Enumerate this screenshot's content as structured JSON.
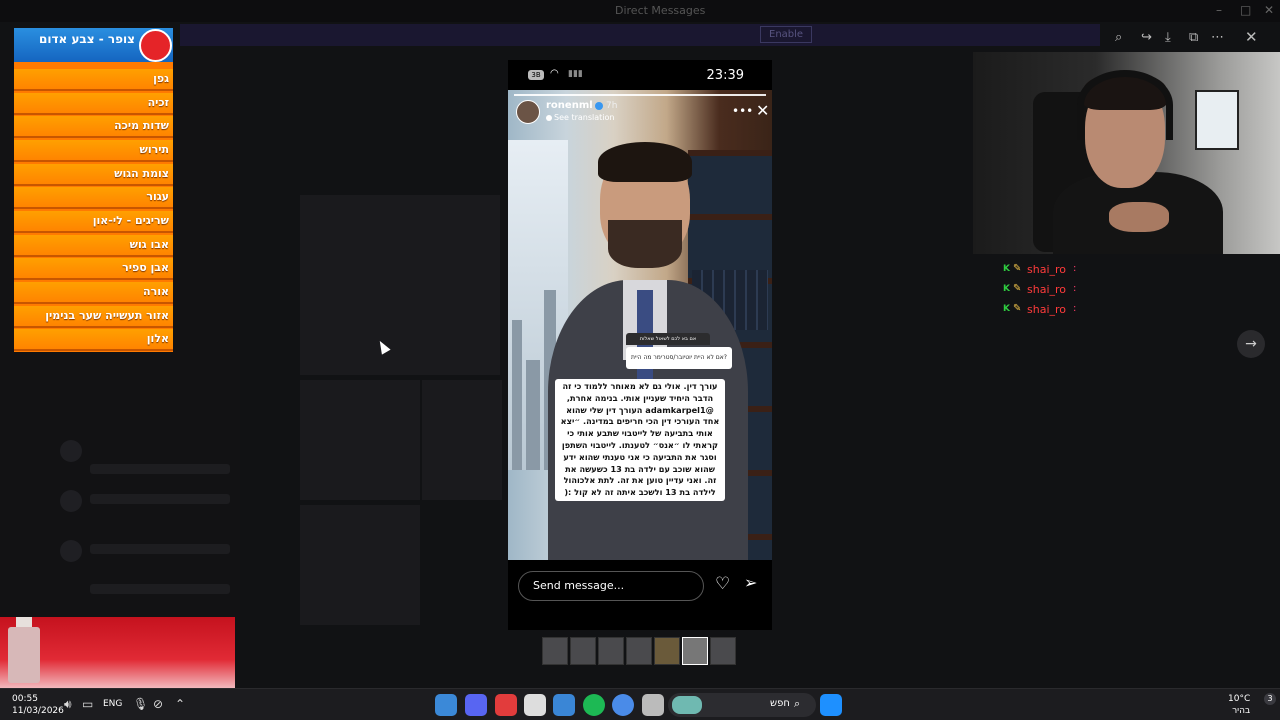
{
  "background_app": {
    "title": "Direct Messages",
    "banner_button": "Enable"
  },
  "menu": {
    "title": "צופר - צבע אדום",
    "logo": "צבע אדום",
    "items": [
      "גפן",
      "זכיה",
      "שדות מיכה",
      "תירוש",
      "צומת הגוש",
      "עגור",
      "שריגים - לי-און",
      "אבו גוש",
      "אבן ספיר",
      "אורה",
      "אזור תעשייה שער בנימין",
      "אלון"
    ]
  },
  "phone": {
    "status": {
      "badge": "3B",
      "time": "23:39"
    },
    "story": {
      "username": "ronenml",
      "time_ago": "7h",
      "see_translation": "See translation",
      "question_top": "אם בא לכם לשאול שאלות",
      "question_bottom": "אם לא היית יוטיובר/סטרימר מה היית?",
      "text": "עורך דין. אולי גם לא מאוחר ללמוד כי זה הדבר היחיד שעניין אותי. בנימה אחרת, @adamkarpel1 העורך דין שלי שהוא אחד העורכי דין הכי חריפים במדינה. ״יצא אותי בתביעה של לייטבוי שתבע אותי כי קראתי לו ״אנס״ לטענתו. לייטבוי השתפן וסגר את התביעה כי אני טענתי שהוא ידע שהוא שוכב עם ילדה בת 13 כשעשה את זה. ואני עדיין טוען את זה. לתת אלכוהול לילדה בת 13 ולשכב איתה זה לא קול :("
    },
    "send_placeholder": "Send message..."
  },
  "chat": [
    {
      "user": "shai_ro",
      "sep": ":"
    },
    {
      "user": "shai_ro",
      "sep": ":"
    },
    {
      "user": "shai_ro",
      "sep": ":"
    }
  ],
  "taskbar": {
    "time": "00:55",
    "date": "11/03/2026",
    "lang": "ENG",
    "search_label": "חפש",
    "temperature": "10°C",
    "weather": "בהיר",
    "notifications": "3"
  }
}
